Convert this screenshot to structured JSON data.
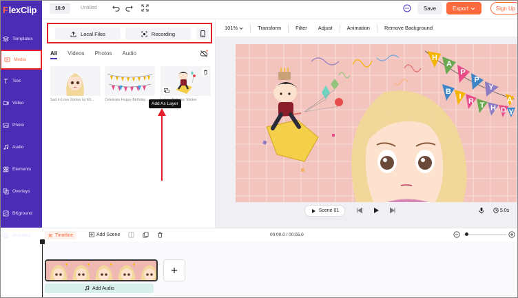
{
  "app": {
    "logo_text": "lexClip",
    "logo_initial": "F"
  },
  "topbar": {
    "ratio": "16:9",
    "project_title": "Untitled",
    "save_label": "Save",
    "export_label": "Export",
    "signup_label": "Sign Up"
  },
  "sidebar": {
    "items": [
      {
        "label": "Templates",
        "icon": "templates-icon"
      },
      {
        "label": "Media",
        "icon": "media-icon",
        "active": true
      },
      {
        "label": "Text",
        "icon": "text-icon"
      },
      {
        "label": "Video",
        "icon": "video-icon"
      },
      {
        "label": "Photo",
        "icon": "photo-icon"
      },
      {
        "label": "Audio",
        "icon": "audio-icon"
      },
      {
        "label": "Elements",
        "icon": "elements-icon"
      },
      {
        "label": "Overlays",
        "icon": "overlays-icon"
      },
      {
        "label": "BKground",
        "icon": "background-icon"
      },
      {
        "label": "Branding",
        "icon": "branding-icon"
      }
    ]
  },
  "media": {
    "local_files_label": "Local Files",
    "recording_label": "Recording",
    "filter_tabs": [
      "All",
      "Videos",
      "Photos",
      "Audio"
    ],
    "items": [
      {
        "label": "Sad in Love Sticker by Ell..."
      },
      {
        "label": "Celebrate Happy Birthday..."
      },
      {
        "label": "Happy Birthday Sticker"
      }
    ],
    "tooltip": "Add As Layer"
  },
  "editor": {
    "zoom": "101%",
    "tools": [
      "Transform",
      "Filter",
      "Adjust",
      "Animation",
      "Remove Background"
    ],
    "banner_letters": [
      "H",
      "A",
      "P",
      "P",
      "Y",
      "B",
      "I",
      "R",
      "T",
      "H",
      "D",
      "A",
      "Y"
    ]
  },
  "player": {
    "scene_label": "Scene 01",
    "duration": "5.0s"
  },
  "timeline": {
    "label": "Timeline",
    "add_scene_label": "Add Scene",
    "timecode": "00:00.0 / 00:05.0",
    "add_audio_label": "Add Audio",
    "zoom_level": 0.05
  },
  "colors": {
    "brand_purple": "#4b2db5",
    "accent_orange": "#ff6a3d",
    "highlight_red": "#e5202b"
  }
}
